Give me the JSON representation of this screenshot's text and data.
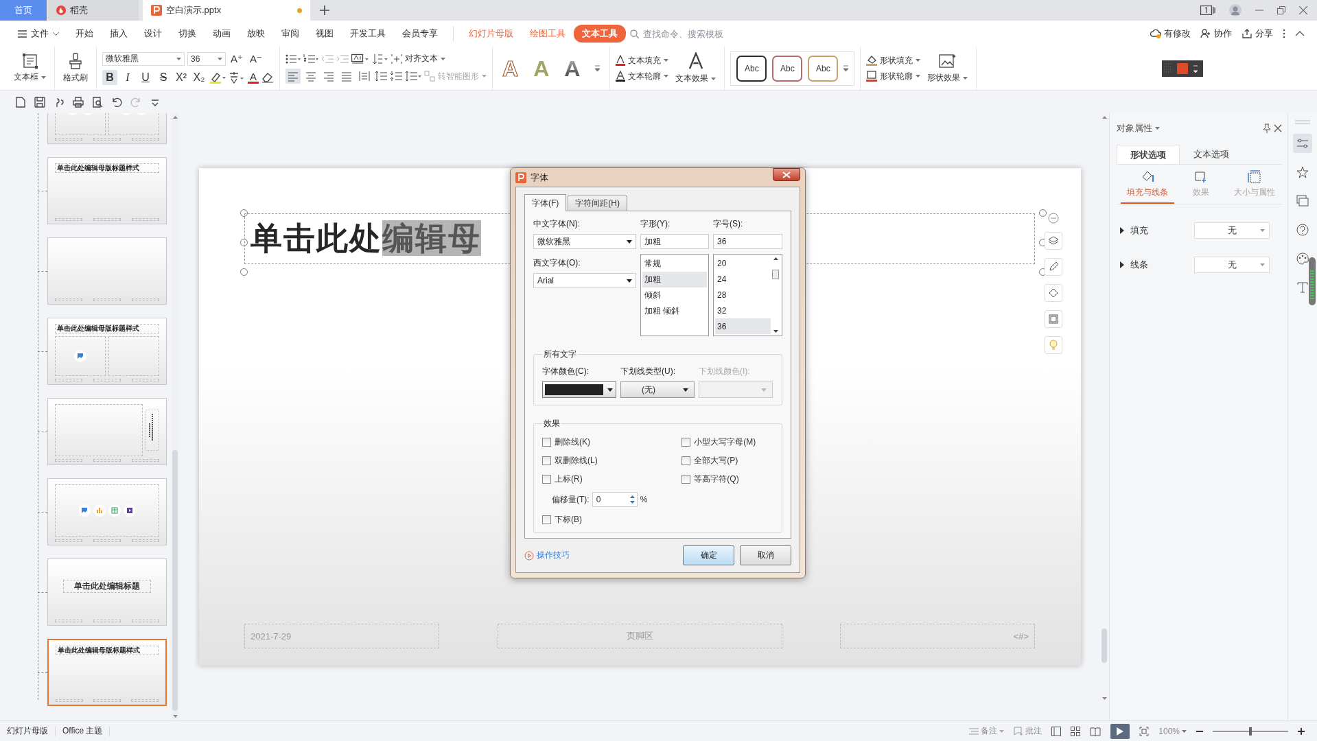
{
  "tabs": [
    {
      "label": "首页",
      "kind": "home",
      "selected": false
    },
    {
      "label": "稻壳",
      "kind": "app",
      "selected": false
    },
    {
      "label": "空白演示.pptx",
      "kind": "doc",
      "selected": true,
      "unsaved": true
    }
  ],
  "menu": [
    {
      "label": "文件",
      "kind": "file",
      "selected": false
    },
    {
      "label": "开始",
      "kind": "plain",
      "selected": false
    },
    {
      "label": "插入",
      "kind": "plain",
      "selected": false
    },
    {
      "label": "设计",
      "kind": "plain",
      "selected": false
    },
    {
      "label": "切换",
      "kind": "plain",
      "selected": false
    },
    {
      "label": "动画",
      "kind": "plain",
      "selected": false
    },
    {
      "label": "放映",
      "kind": "plain",
      "selected": false
    },
    {
      "label": "审阅",
      "kind": "plain",
      "selected": false
    },
    {
      "label": "视图",
      "kind": "plain",
      "selected": false
    },
    {
      "label": "开发工具",
      "kind": "plain",
      "selected": false
    },
    {
      "label": "会员专享",
      "kind": "plain",
      "selected": false
    },
    {
      "label": "幻灯片母版",
      "kind": "context",
      "selected": false
    },
    {
      "label": "绘图工具",
      "kind": "context",
      "selected": false
    },
    {
      "label": "文本工具",
      "kind": "context",
      "selected": true
    }
  ],
  "search": {
    "placeholder": "查找命令、搜索模板"
  },
  "account_actions": [
    {
      "label": "有修改",
      "kind": "cloud"
    },
    {
      "label": "协作",
      "kind": "people"
    },
    {
      "label": "分享",
      "kind": "share"
    }
  ],
  "ribbon": {
    "text_box": "文本框",
    "format_painter": "格式刷",
    "font": "微软雅黑",
    "font_size": "36",
    "size_buttons": [
      "A⁺",
      "A⁻"
    ],
    "format_buttons": [
      {
        "label": "B",
        "kind": "bold",
        "on": true
      },
      {
        "label": "I",
        "kind": "italic",
        "on": false
      },
      {
        "label": "U",
        "kind": "underline",
        "on": false
      },
      {
        "label": "S",
        "kind": "strike",
        "on": false
      },
      {
        "label": "X²",
        "kind": "plain",
        "on": false
      },
      {
        "label": "X₂",
        "kind": "plain",
        "on": false
      }
    ],
    "font_color_button": "A",
    "align_buttons": [
      {
        "kind": "left",
        "selected": true
      },
      {
        "kind": "center",
        "selected": false
      },
      {
        "kind": "right",
        "selected": false
      },
      {
        "kind": "justify",
        "selected": false
      },
      {
        "kind": "distribute",
        "selected": false
      }
    ],
    "align_text": "对齐文本",
    "smart_art": {
      "label": "转智能图形",
      "disabled": true
    },
    "wordart": [
      {
        "label": "A",
        "kind": "outline"
      },
      {
        "label": "A",
        "kind": "fill"
      },
      {
        "label": "A",
        "kind": "gradient"
      }
    ],
    "text_fill": "文本填充",
    "text_outline": "文本轮廓",
    "text_effect": "文本效果",
    "shape_styles": [
      {
        "label": "Abc",
        "color": "#2b2b2b"
      },
      {
        "label": "Abc",
        "color": "#b86b6b"
      },
      {
        "label": "Abc",
        "color": "#c9a46a"
      }
    ],
    "shape_fill": "形状填充",
    "shape_outline": "形状轮廓",
    "shape_effect": "形状效果"
  },
  "thumbnails": [
    {
      "kind": "media",
      "selected": false
    },
    {
      "kind": "title",
      "title": "单击此处编辑母版标题样式",
      "selected": false
    },
    {
      "kind": "blank",
      "selected": false
    },
    {
      "kind": "two",
      "title": "单击此处编辑母版标题样式",
      "selected": false
    },
    {
      "kind": "vertical",
      "selected": false
    },
    {
      "kind": "content",
      "selected": false
    },
    {
      "kind": "cover",
      "title": "单击此处编辑标题",
      "selected": false
    },
    {
      "kind": "title",
      "title": "单击此处编辑母版标题样式",
      "selected": true
    }
  ],
  "slide": {
    "title_parts": [
      {
        "text": "单击此处",
        "selected": false
      },
      {
        "text": "编辑母",
        "selected": true
      }
    ],
    "footer": {
      "date": "2021-7-29",
      "text": "页脚区",
      "number": "<#>"
    }
  },
  "dialog": {
    "title": "字体",
    "tabs": [
      {
        "label": "字体(F)",
        "selected": true
      },
      {
        "label": "字符间距(H)",
        "selected": false
      }
    ],
    "cn_font": {
      "label": "中文字体(N):",
      "value": "微软雅黑"
    },
    "west_font": {
      "label": "西文字体(O):",
      "value": "Arial"
    },
    "style": {
      "label": "字形(Y):",
      "value": "加粗",
      "options": [
        {
          "label": "常规",
          "selected": false
        },
        {
          "label": "加粗",
          "selected": true
        },
        {
          "label": "倾斜",
          "selected": false
        },
        {
          "label": "加粗 倾斜",
          "selected": false
        }
      ]
    },
    "size": {
      "label": "字号(S):",
      "value": "36",
      "options": [
        {
          "label": "20",
          "selected": false
        },
        {
          "label": "24",
          "selected": false
        },
        {
          "label": "28",
          "selected": false
        },
        {
          "label": "32",
          "selected": false
        },
        {
          "label": "36",
          "selected": true
        }
      ]
    },
    "all_text": {
      "title": "所有文字",
      "font_color": {
        "label": "字体颜色(C):",
        "color": "#222222"
      },
      "underline_type": {
        "label": "下划线类型(U):",
        "value": "(无)"
      },
      "underline_color": {
        "label": "下划线颜色(I):",
        "disabled": true
      }
    },
    "effects": {
      "title": "效果",
      "left": [
        {
          "label": "删除线(K)",
          "checked": false
        },
        {
          "label": "双删除线(L)",
          "checked": false
        },
        {
          "label": "上标(R)",
          "checked": false
        }
      ],
      "offset": {
        "label": "偏移量(T):",
        "value": "0",
        "unit": "%"
      },
      "subscript": {
        "label": "下标(B)",
        "checked": false
      },
      "right": [
        {
          "label": "小型大写字母(M)",
          "checked": false
        },
        {
          "label": "全部大写(P)",
          "checked": false
        },
        {
          "label": "等高字符(Q)",
          "checked": false
        }
      ]
    },
    "tips": "操作技巧",
    "buttons": [
      {
        "label": "确定",
        "kind": "primary"
      },
      {
        "label": "取消",
        "kind": "normal"
      }
    ]
  },
  "panel": {
    "title": "对象属性",
    "tabs": [
      {
        "label": "形状选项",
        "selected": true
      },
      {
        "label": "文本选项",
        "selected": false
      }
    ],
    "subtabs": [
      {
        "label": "填充与线条",
        "kind": "fill",
        "selected": true
      },
      {
        "label": "效果",
        "kind": "effect",
        "selected": false
      },
      {
        "label": "大小与属性",
        "kind": "size",
        "selected": false
      }
    ],
    "rows": [
      {
        "label": "填充",
        "value": "无",
        "expanded": false
      },
      {
        "label": "线条",
        "value": "无",
        "expanded": false
      }
    ]
  },
  "status": {
    "left": [
      "幻灯片母版",
      "Office 主题"
    ],
    "notes": "备注",
    "comments": "批注",
    "zoom": "100%",
    "zoom_slider": {
      "level": 0.5
    }
  }
}
